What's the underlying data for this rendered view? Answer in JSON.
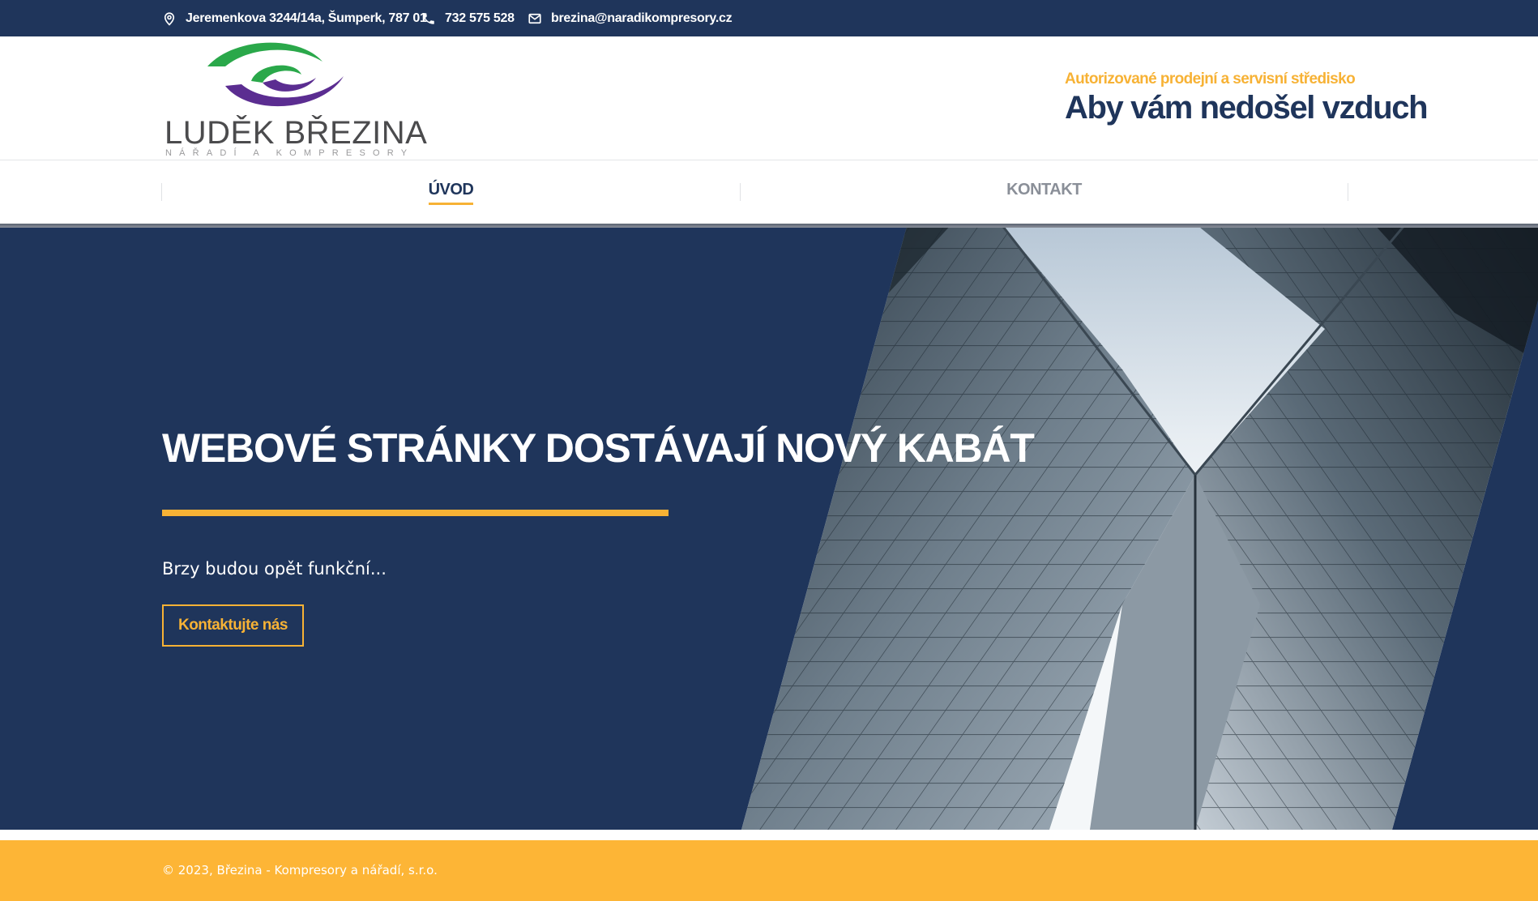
{
  "topbar": {
    "address": "Jeremenkova 3244/14a, Šumperk, 787 01",
    "phone": "732 575 528",
    "email": "brezina@naradikompresory.cz",
    "address_icon": "map-pin-icon",
    "phone_icon": "phone-icon",
    "email_icon": "envelope-icon"
  },
  "header": {
    "logo_name": "LUDĚK BŘEZINA",
    "logo_sub": "NÁŘADÍ A KOMPRESORY",
    "tagline_sub": "Autorizované prodejní a servisní středisko",
    "tagline_main": "Aby vám nedošel vzduch"
  },
  "nav": {
    "items": [
      {
        "label": "ÚVOD",
        "active": true
      },
      {
        "label": "KONTAKT",
        "active": false
      }
    ]
  },
  "hero": {
    "title": "WEBOVÉ STRÁNKY DOSTÁVAJÍ NOVÝ KABÁT",
    "lead": "Brzy budou opět funkční...",
    "cta_label": "Kontaktujte nás"
  },
  "footer": {
    "copyright": "© 2023, Březina - Kompresory a nářadí, s.r.o."
  },
  "colors": {
    "navy": "#1f355b",
    "accent": "#f7b235",
    "footer": "#fdb536",
    "logo_green": "#2aa84a",
    "logo_purple": "#5b2d91"
  }
}
